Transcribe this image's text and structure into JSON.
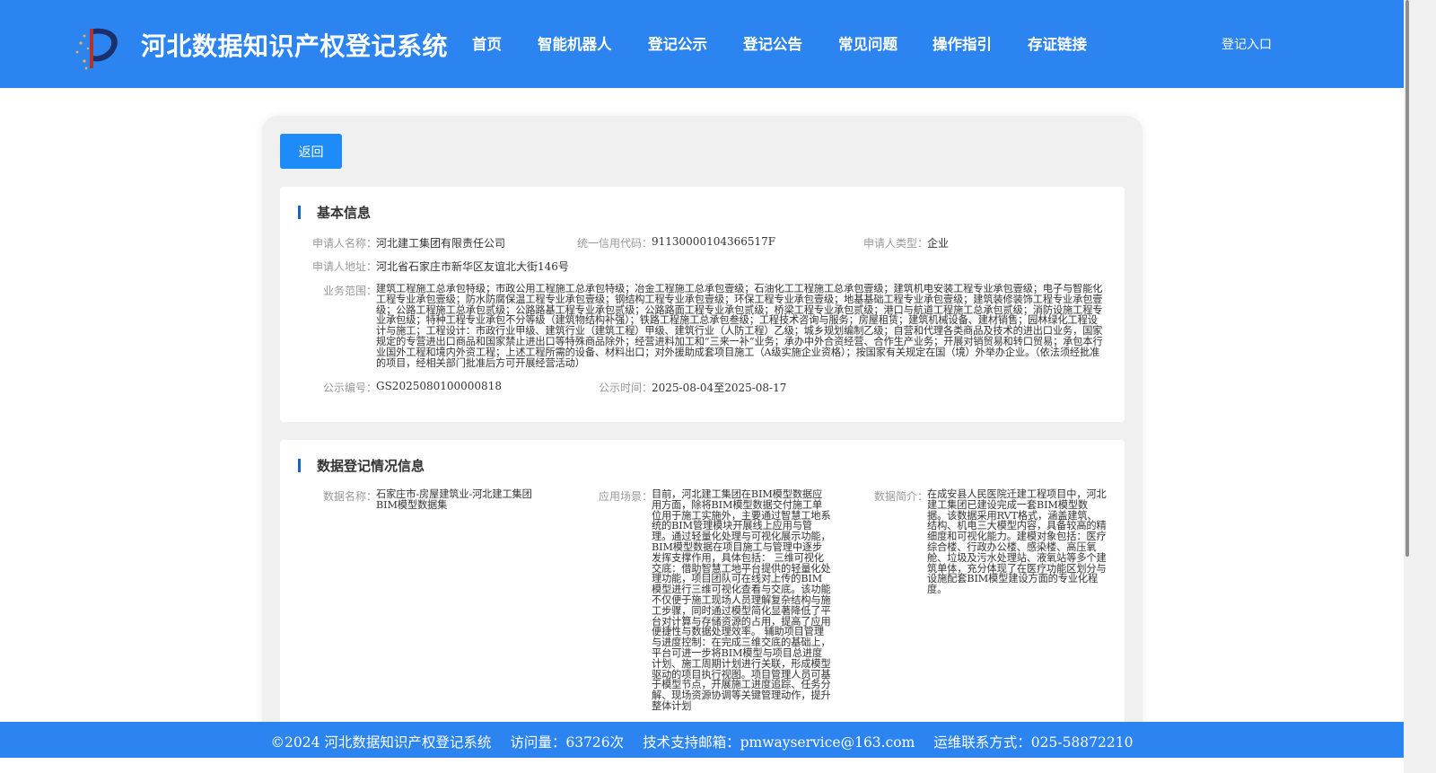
{
  "header": {
    "site_title": "河北数据知识产权登记系统",
    "nav": [
      "首页",
      "智能机器人",
      "登记公示",
      "登记公告",
      "常见问题",
      "操作指引",
      "存证链接"
    ],
    "login": "登记入口"
  },
  "back_label": "返回",
  "basic": {
    "title": "基本信息",
    "applicant_name_label": "申请人名称：",
    "applicant_name": "河北建工集团有限责任公司",
    "credit_code_label": "统一信用代码：",
    "credit_code": "91130000104366517F",
    "applicant_type_label": "申请人类型：",
    "applicant_type": "企业",
    "address_label": "申请人地址：",
    "address": "河北省石家庄市新华区友谊北大街146号",
    "scope_label": "业务范围：",
    "scope": "建筑工程施工总承包特级；市政公用工程施工总承包特级；冶金工程施工总承包壹级；石油化工工程施工总承包壹级；建筑机电安装工程专业承包壹级；电子与智能化工程专业承包壹级；防水防腐保温工程专业承包壹级；钢结构工程专业承包壹级；环保工程专业承包壹级；地基基础工程专业承包壹级；建筑装修装饰工程专业承包壹级；公路工程施工总承包贰级；公路路基工程专业承包贰级；公路路面工程专业承包贰级；桥梁工程专业承包贰级；港口与航道工程施工总承包贰级；消防设施工程专业承包级；特种工程专业承包不分等级（建筑物结构补强）；铁路工程施工总承包叁级；工程技术咨询与服务；房屋租赁；建筑机械设备、建材销售；园林绿化工程设计与施工；工程设计：市政行业甲级、建筑行业（建筑工程）甲级、建筑行业（人防工程）乙级；城乡规划编制乙级；自营和代理各类商品及技术的进出口业务，国家规定的专营进出口商品和国家禁止进出口等特殊商品除外；经营进料加工和“三来一补”业务；承办中外合资经营、合作生产业务；开展对销贸易和转口贸易；承包本行业国外工程和境内外资工程；上述工程所需的设备、材料出口；对外援助成套项目施工（A级实施企业资格）；按国家有关规定在国（境）外举办企业。（依法须经批准的项目，经相关部门批准后方可开展经营活动）",
    "pub_no_label": "公示编号：",
    "pub_no": "GS2025080100000818",
    "pub_time_label": "公示时间：",
    "pub_time": "2025-08-04至2025-08-17"
  },
  "data_info": {
    "title": "数据登记情况信息",
    "name_label": "数据名称：",
    "name": "石家庄市-房屋建筑业-河北建工集团BIM模型数据集",
    "scene_label": "应用场景：",
    "scene": "目前，河北建工集团在BIM模型数据应用方面，除将BIM模型数据交付施工单位用于施工实施外，主要通过智慧工地系统的BIM管理模块开展线上应用与管理。通过轻量化处理与可视化展示功能，BIM模型数据在项目施工与管理中逐步发挥支撑作用，具体包括： 三维可视化交底：借助智慧工地平台提供的轻量化处理功能，项目团队可在线对上传的BIM模型进行三维可视化查看与交底。该功能不仅便于施工现场人员理解复杂结构与施工步骤，同时通过模型简化显著降低了平台对计算与存储资源的占用，提高了应用便捷性与数据处理效率。 辅助项目管理与进度控制：在完成三维交底的基础上，平台可进一步将BIM模型与项目总进度计划、施工周期计划进行关联，形成模型驱动的项目执行视图。项目管理人员可基于模型节点，开展施工进度追踪、任务分解、现场资源协调等关键管理动作，提升整体计划",
    "intro_label": "数据简介：",
    "intro": "在成安县人民医院迁建工程项目中，河北建工集团已建设完成一套BIM模型数据。该数据采用RVT格式，涵盖建筑、结构、机电三大模型内容，具备较高的精细度和可视化能力。建模对象包括：医疗综合楼、行政办公楼、感染楼、高压氧舱、垃圾及污水处理站、液氧站等多个建筑单体，充分体现了在医疗功能区划分与设施配套BIM模型建设方面的专业化程度。"
  },
  "footer": {
    "copyright": "©2024 河北数据知识产权登记系统",
    "visits": "访问量：63726次",
    "email": "技术支持邮箱：pmwayservice@163.com",
    "phone": "运维联系方式：025-58872210"
  }
}
